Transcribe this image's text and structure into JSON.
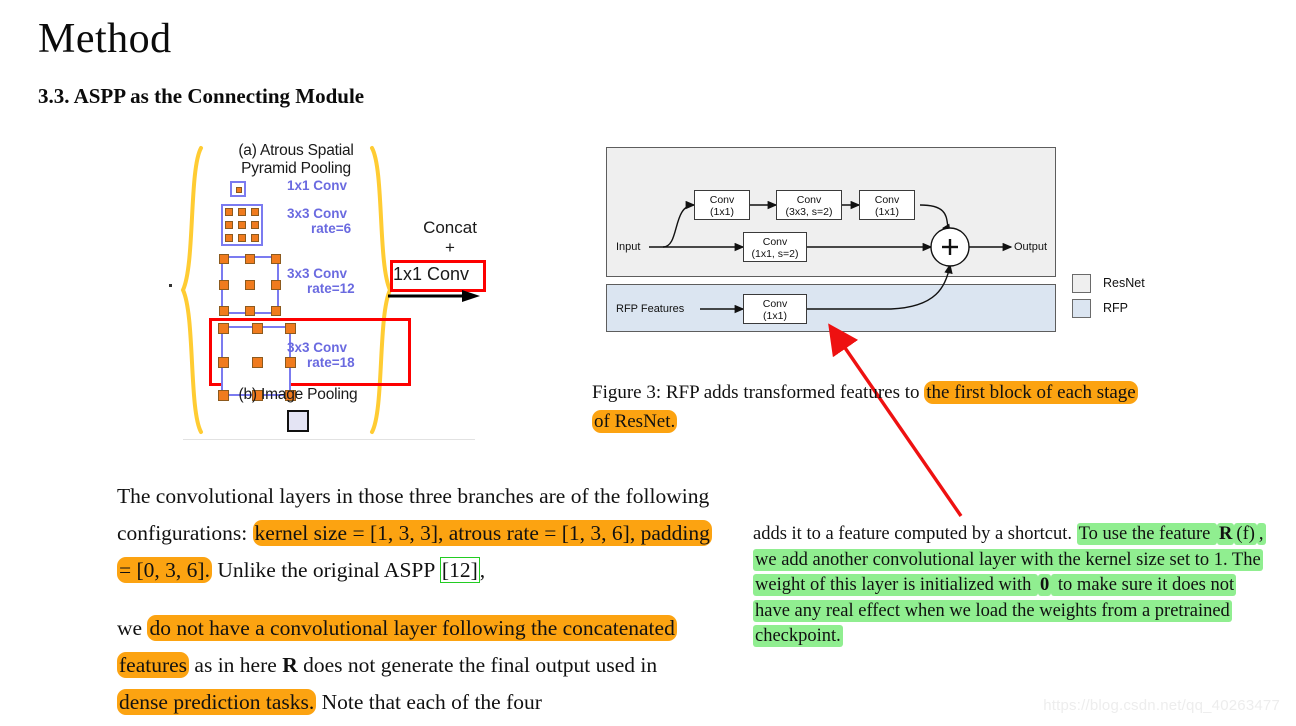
{
  "page": {
    "title": "Method",
    "section_heading": "3.3. ASPP as the Connecting Module",
    "watermark": "https://blog.csdn.net/qq_40263477"
  },
  "aspp_figure": {
    "part_a_title_line1": "(a) Atrous Spatial",
    "part_a_title_line2": "Pyramid Pooling",
    "part_b_title": "(b) Image Pooling",
    "branches": [
      {
        "label_line1": "1x1 Conv",
        "label_line2": "",
        "rate": null,
        "grid": "single-dot"
      },
      {
        "label_line1": "3x3 Conv",
        "label_line2": "rate=6",
        "rate": 6,
        "grid": "3x3-dense"
      },
      {
        "label_line1": "3x3 Conv",
        "label_line2": "rate=12",
        "rate": 12,
        "grid": "3x3-medium"
      },
      {
        "label_line1": "3x3 Conv",
        "label_line2": "rate=18",
        "rate": 18,
        "grid": "3x3-sparse"
      }
    ],
    "concat_line1": "Concat",
    "concat_line2": "+",
    "concat_box_label": "1x1 Conv",
    "colors": {
      "brace": "#ffcc33",
      "conv_label": "#6a6ae0",
      "grid_border": "#7b7bf0",
      "dot": "#f07b1e",
      "red_highlight": "#fd0000"
    }
  },
  "rfp_figure": {
    "input_label": "Input",
    "output_label": "Output",
    "rfp_features_label": "RFP Features",
    "sum_symbol": "+",
    "top_path_boxes": [
      {
        "line1": "Conv",
        "line2": "(1x1)"
      },
      {
        "line1": "Conv",
        "line2": "(3x3, s=2)"
      },
      {
        "line1": "Conv",
        "line2": "(1x1)"
      }
    ],
    "shortcut_box": {
      "line1": "Conv",
      "line2": "(1x1, s=2)"
    },
    "rfp_box": {
      "line1": "Conv",
      "line2": "(1x1)"
    },
    "legend": [
      {
        "label": "ResNet",
        "color": "#efefef"
      },
      {
        "label": "RFP",
        "color": "#dbe5f1"
      }
    ]
  },
  "caption": {
    "prefix": "Figure 3: RFP adds transformed features to ",
    "highlight": "the first block of each stage of ResNet."
  },
  "body_left": {
    "para1": {
      "pre": "The convolutional layers in those three branches are of the following configurations: ",
      "highlight": "kernel size = [1, 3, 3], atrous rate = [1, 3, 6], padding = [0, 3, 6].",
      "post_a": " Unlike the original ASPP ",
      "reference": "[12]",
      "post_b": ","
    },
    "para2": {
      "pre": "we ",
      "highlight_a": "do not have a convolutional layer following the concatenated features",
      "mid_a": " as in here ",
      "math": "R",
      "mid_b": " does not generate the final output used in ",
      "highlight_b": "dense prediction tasks.",
      "post": " Note that each of the four"
    }
  },
  "body_right": {
    "pre": "adds it to a feature computed by a shortcut. ",
    "highlight_part1": "To use the feature ",
    "math_r": "R",
    "math_f": "(f)",
    "highlight_part2": ", we add another convolutional layer with the kernel size set to 1. The weight of this layer is initialized with ",
    "math_zero": "0",
    "highlight_part3": " to make sure it does not have any real effect when we load the weights from a pretrained checkpoint."
  },
  "colors": {
    "orange_highlight": "#fca311",
    "green_highlight": "#90ee90",
    "red_annotation": "#ee1111",
    "reference_box": "#22cc22"
  }
}
